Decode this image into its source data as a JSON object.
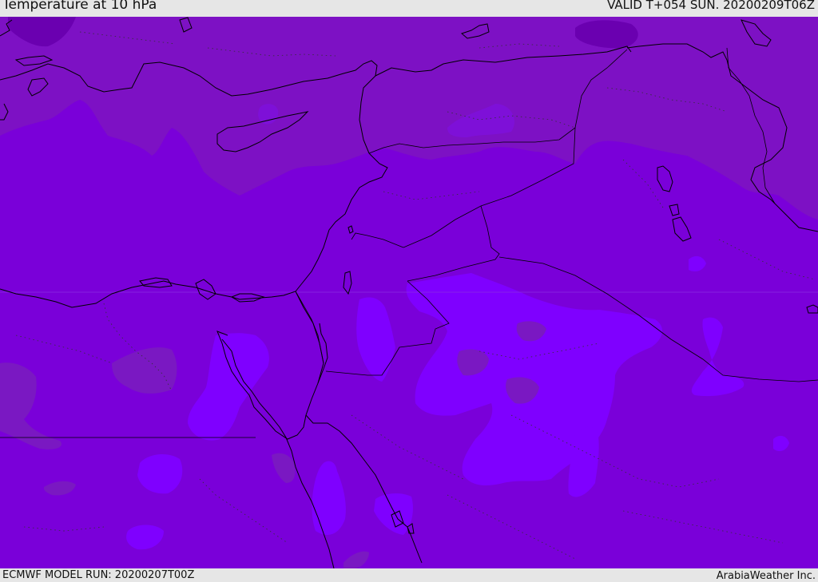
{
  "header": {
    "title": "Temperature at 10 hPa",
    "valid_time": "VALID T+054 SUN. 20200209T06Z"
  },
  "footer": {
    "model_run": "ECMWF MODEL RUN: 20200207T00Z",
    "credit": "ArabiaWeather Inc."
  },
  "map": {
    "region": "Eastern Mediterranean and Middle East",
    "colors": {
      "base_field": "#7a00d9",
      "warm_band_north": "#7d11c4",
      "cool_patch": "#7f00ff",
      "dark_patch": "#7a18c2",
      "coastline": "#000000"
    }
  }
}
